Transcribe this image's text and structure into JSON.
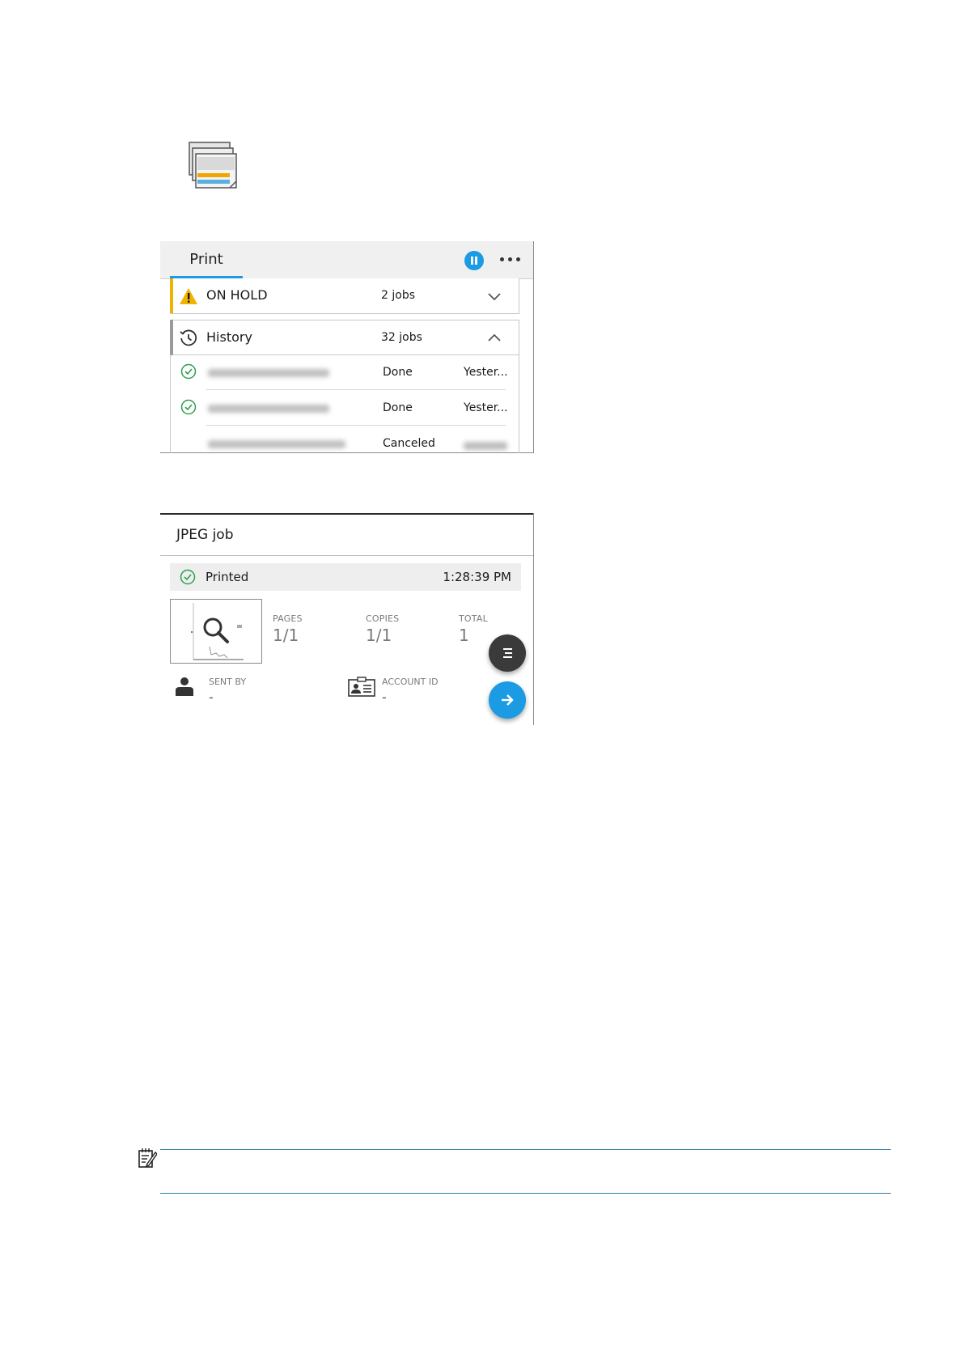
{
  "print_panel": {
    "tab_label": "Print",
    "groups": [
      {
        "label": "ON HOLD",
        "count": "2 jobs",
        "expanded": false,
        "accent": "#f0b400"
      },
      {
        "label": "History",
        "count": "32 jobs",
        "expanded": true,
        "accent": "#9a9a9a"
      }
    ],
    "jobs": [
      {
        "status": "Done",
        "date": "Yester..."
      },
      {
        "status": "Done",
        "date": "Yester..."
      },
      {
        "status": "Canceled",
        "date": ""
      }
    ]
  },
  "job_panel": {
    "title": "JPEG job",
    "status": "Printed",
    "time": "1:28:39 PM",
    "stats": {
      "pages_label": "PAGES",
      "pages_value": "1/1",
      "copies_label": "COPIES",
      "copies_value": "1/1",
      "total_label": "TOTAL",
      "total_value": "1"
    },
    "sent_by_label": "SENT BY",
    "sent_by_value": "-",
    "account_id_label": "ACCOUNT ID",
    "account_id_value": "-"
  },
  "colors": {
    "accent_blue": "#1a9be3",
    "warning_yellow": "#f0b400",
    "success_green": "#2e9e4f",
    "fab_dark": "#3a3a3a",
    "note_rule": "#2a7fa6"
  }
}
